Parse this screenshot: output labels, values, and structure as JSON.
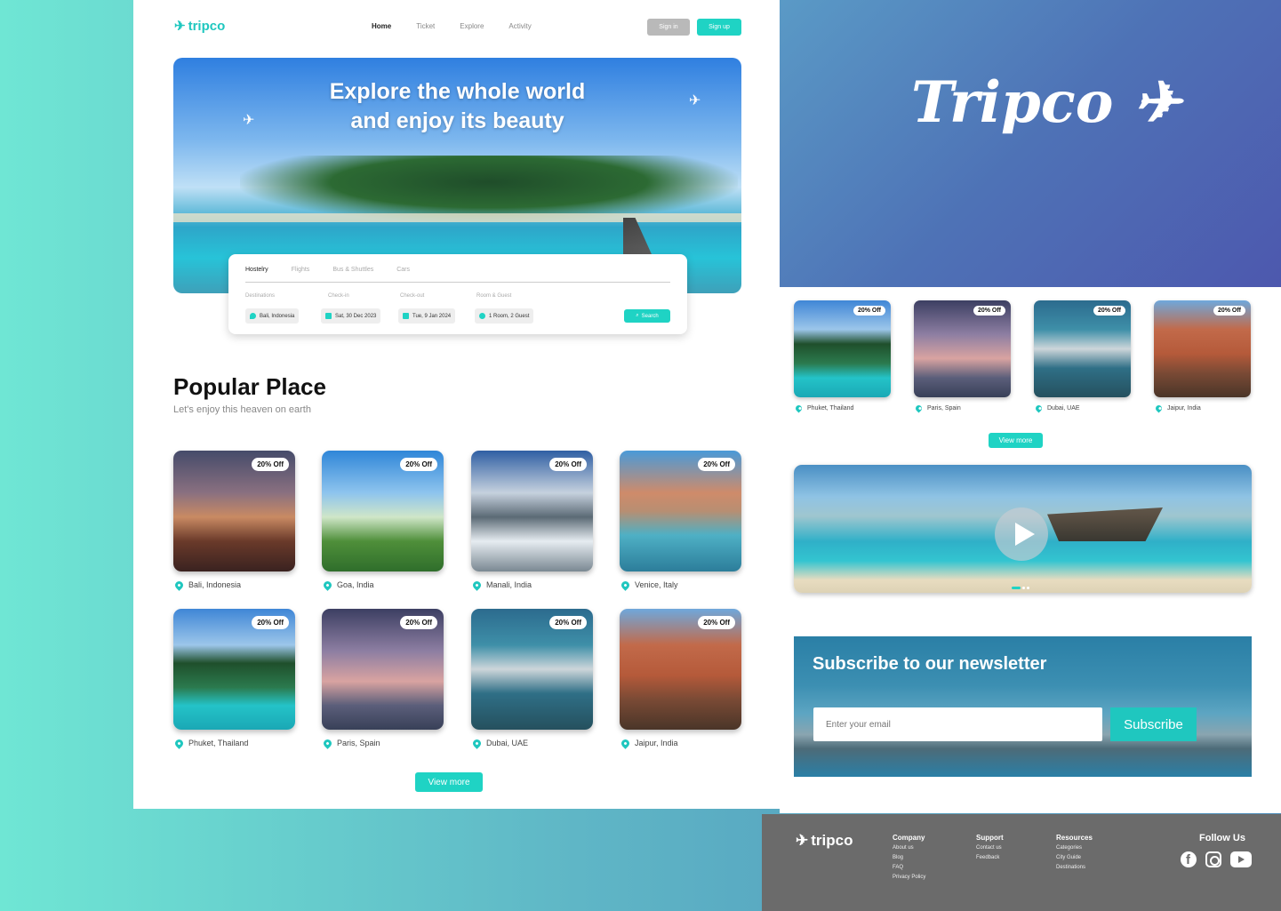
{
  "nav": {
    "logo": "tripco",
    "links": [
      "Home",
      "Ticket",
      "Explore",
      "Activity"
    ],
    "signin": "Sign in",
    "signup": "Sign up"
  },
  "hero": {
    "title_line1": "Explore the whole world",
    "title_line2": "and enjoy its beauty"
  },
  "search": {
    "tabs": [
      "Hostelry",
      "Flights",
      "Bus & Shuttles",
      "Cars"
    ],
    "labels": [
      "Destinations",
      "Check-in",
      "Check-out",
      "Room & Guest"
    ],
    "destination": "Bali, Indonesia",
    "checkin": "Sat, 30 Dec 2023",
    "checkout": "Tue, 9 Jan 2024",
    "room_guest": "1 Room, 2 Guest",
    "button": "Search"
  },
  "popular": {
    "title": "Popular Place",
    "subtitle": "Let's enjoy this heaven on earth",
    "badge": "20% Off",
    "places": [
      {
        "name": "Bali, Indonesia"
      },
      {
        "name": "Goa, India"
      },
      {
        "name": "Manali, India"
      },
      {
        "name": "Venice, Italy"
      },
      {
        "name": "Phuket, Thailand"
      },
      {
        "name": "Paris, Spain"
      },
      {
        "name": "Dubai, UAE"
      },
      {
        "name": "Jaipur, India"
      }
    ],
    "view_more": "View more"
  },
  "brand": {
    "name": "Tripco"
  },
  "right": {
    "places": [
      {
        "name": "Phuket, Thailand"
      },
      {
        "name": "Paris, Spain"
      },
      {
        "name": "Dubai, UAE"
      },
      {
        "name": "Jaipur, India"
      }
    ],
    "badge": "20% Off",
    "view_more": "View more"
  },
  "newsletter": {
    "title": "Subscribe to our newsletter",
    "placeholder": "Enter your email",
    "button": "Subscribe"
  },
  "footer": {
    "logo": "tripco",
    "company": {
      "heading": "Company",
      "links": [
        "About us",
        "Blog",
        "FAQ",
        "Privacy Policy"
      ]
    },
    "support": {
      "heading": "Support",
      "links": [
        "Contact us",
        "Feedback"
      ]
    },
    "resources": {
      "heading": "Resources",
      "links": [
        "Categories",
        "City Guide",
        "Destinations"
      ]
    },
    "follow": "Follow Us"
  },
  "colors": {
    "accent": "#1fd3c4",
    "brand_bg": "#4e72b6",
    "footer_bg": "#6b6b6b"
  }
}
